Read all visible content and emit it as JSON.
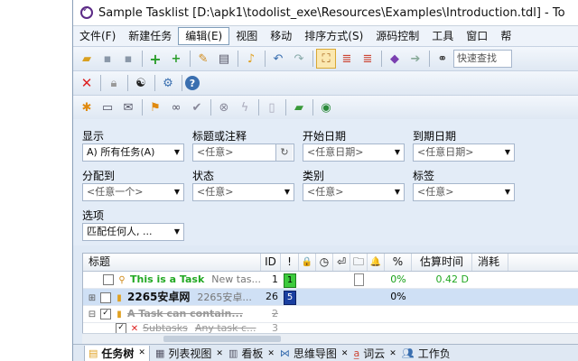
{
  "window": {
    "title": "Sample Tasklist [D:\\apk1\\todolist_exe\\Resources\\Examples\\Introduction.tdl] - To"
  },
  "menu": [
    "文件(F)",
    "新建任务",
    "编辑(E)",
    "视图",
    "移动",
    "排序方式(S)",
    "源码控制",
    "工具",
    "窗口",
    "帮"
  ],
  "toolbar": {
    "quickfind_placeholder": "快速查找"
  },
  "filters": {
    "show_label": "显示",
    "show_value": "A) 所有任务(A)",
    "title_label": "标题或注释",
    "title_value": "<任意>",
    "start_label": "开始日期",
    "start_value": "<任意日期>",
    "due_label": "到期日期",
    "due_value": "<任意日期>",
    "assigned_label": "分配到",
    "assigned_value": "<任意一个>",
    "status_label": "状态",
    "status_value": "<任意>",
    "category_label": "类别",
    "category_value": "<任意>",
    "tags_label": "标签",
    "tags_value": "<任意>",
    "options_label": "选项",
    "options_value": "匹配任何人, ..."
  },
  "grid": {
    "columns": [
      "标题",
      "ID",
      "!",
      "🔒",
      "◷",
      "⏎",
      "🗀",
      "🔔",
      "%",
      "估算时间",
      "消耗"
    ],
    "rows": [
      {
        "title": "This is a Task",
        "comment": "New tas...",
        "id": "1",
        "priority": "1",
        "percent": "0%",
        "estimate": "0.42 D"
      },
      {
        "title": "2265安卓网",
        "comment": "2265安卓...",
        "id": "26",
        "priority": "5",
        "percent": "0%",
        "estimate": ""
      },
      {
        "title": "A Task can contain...",
        "comment": "",
        "id": "2",
        "priority": "",
        "percent": "",
        "estimate": ""
      },
      {
        "title": "Subtasks",
        "comment": "Any task c...",
        "id": "3",
        "priority": "",
        "percent": "",
        "estimate": ""
      }
    ]
  },
  "tabs": [
    "任务树",
    "列表视图",
    "看板",
    "思维导图",
    "词云",
    "工作负"
  ]
}
